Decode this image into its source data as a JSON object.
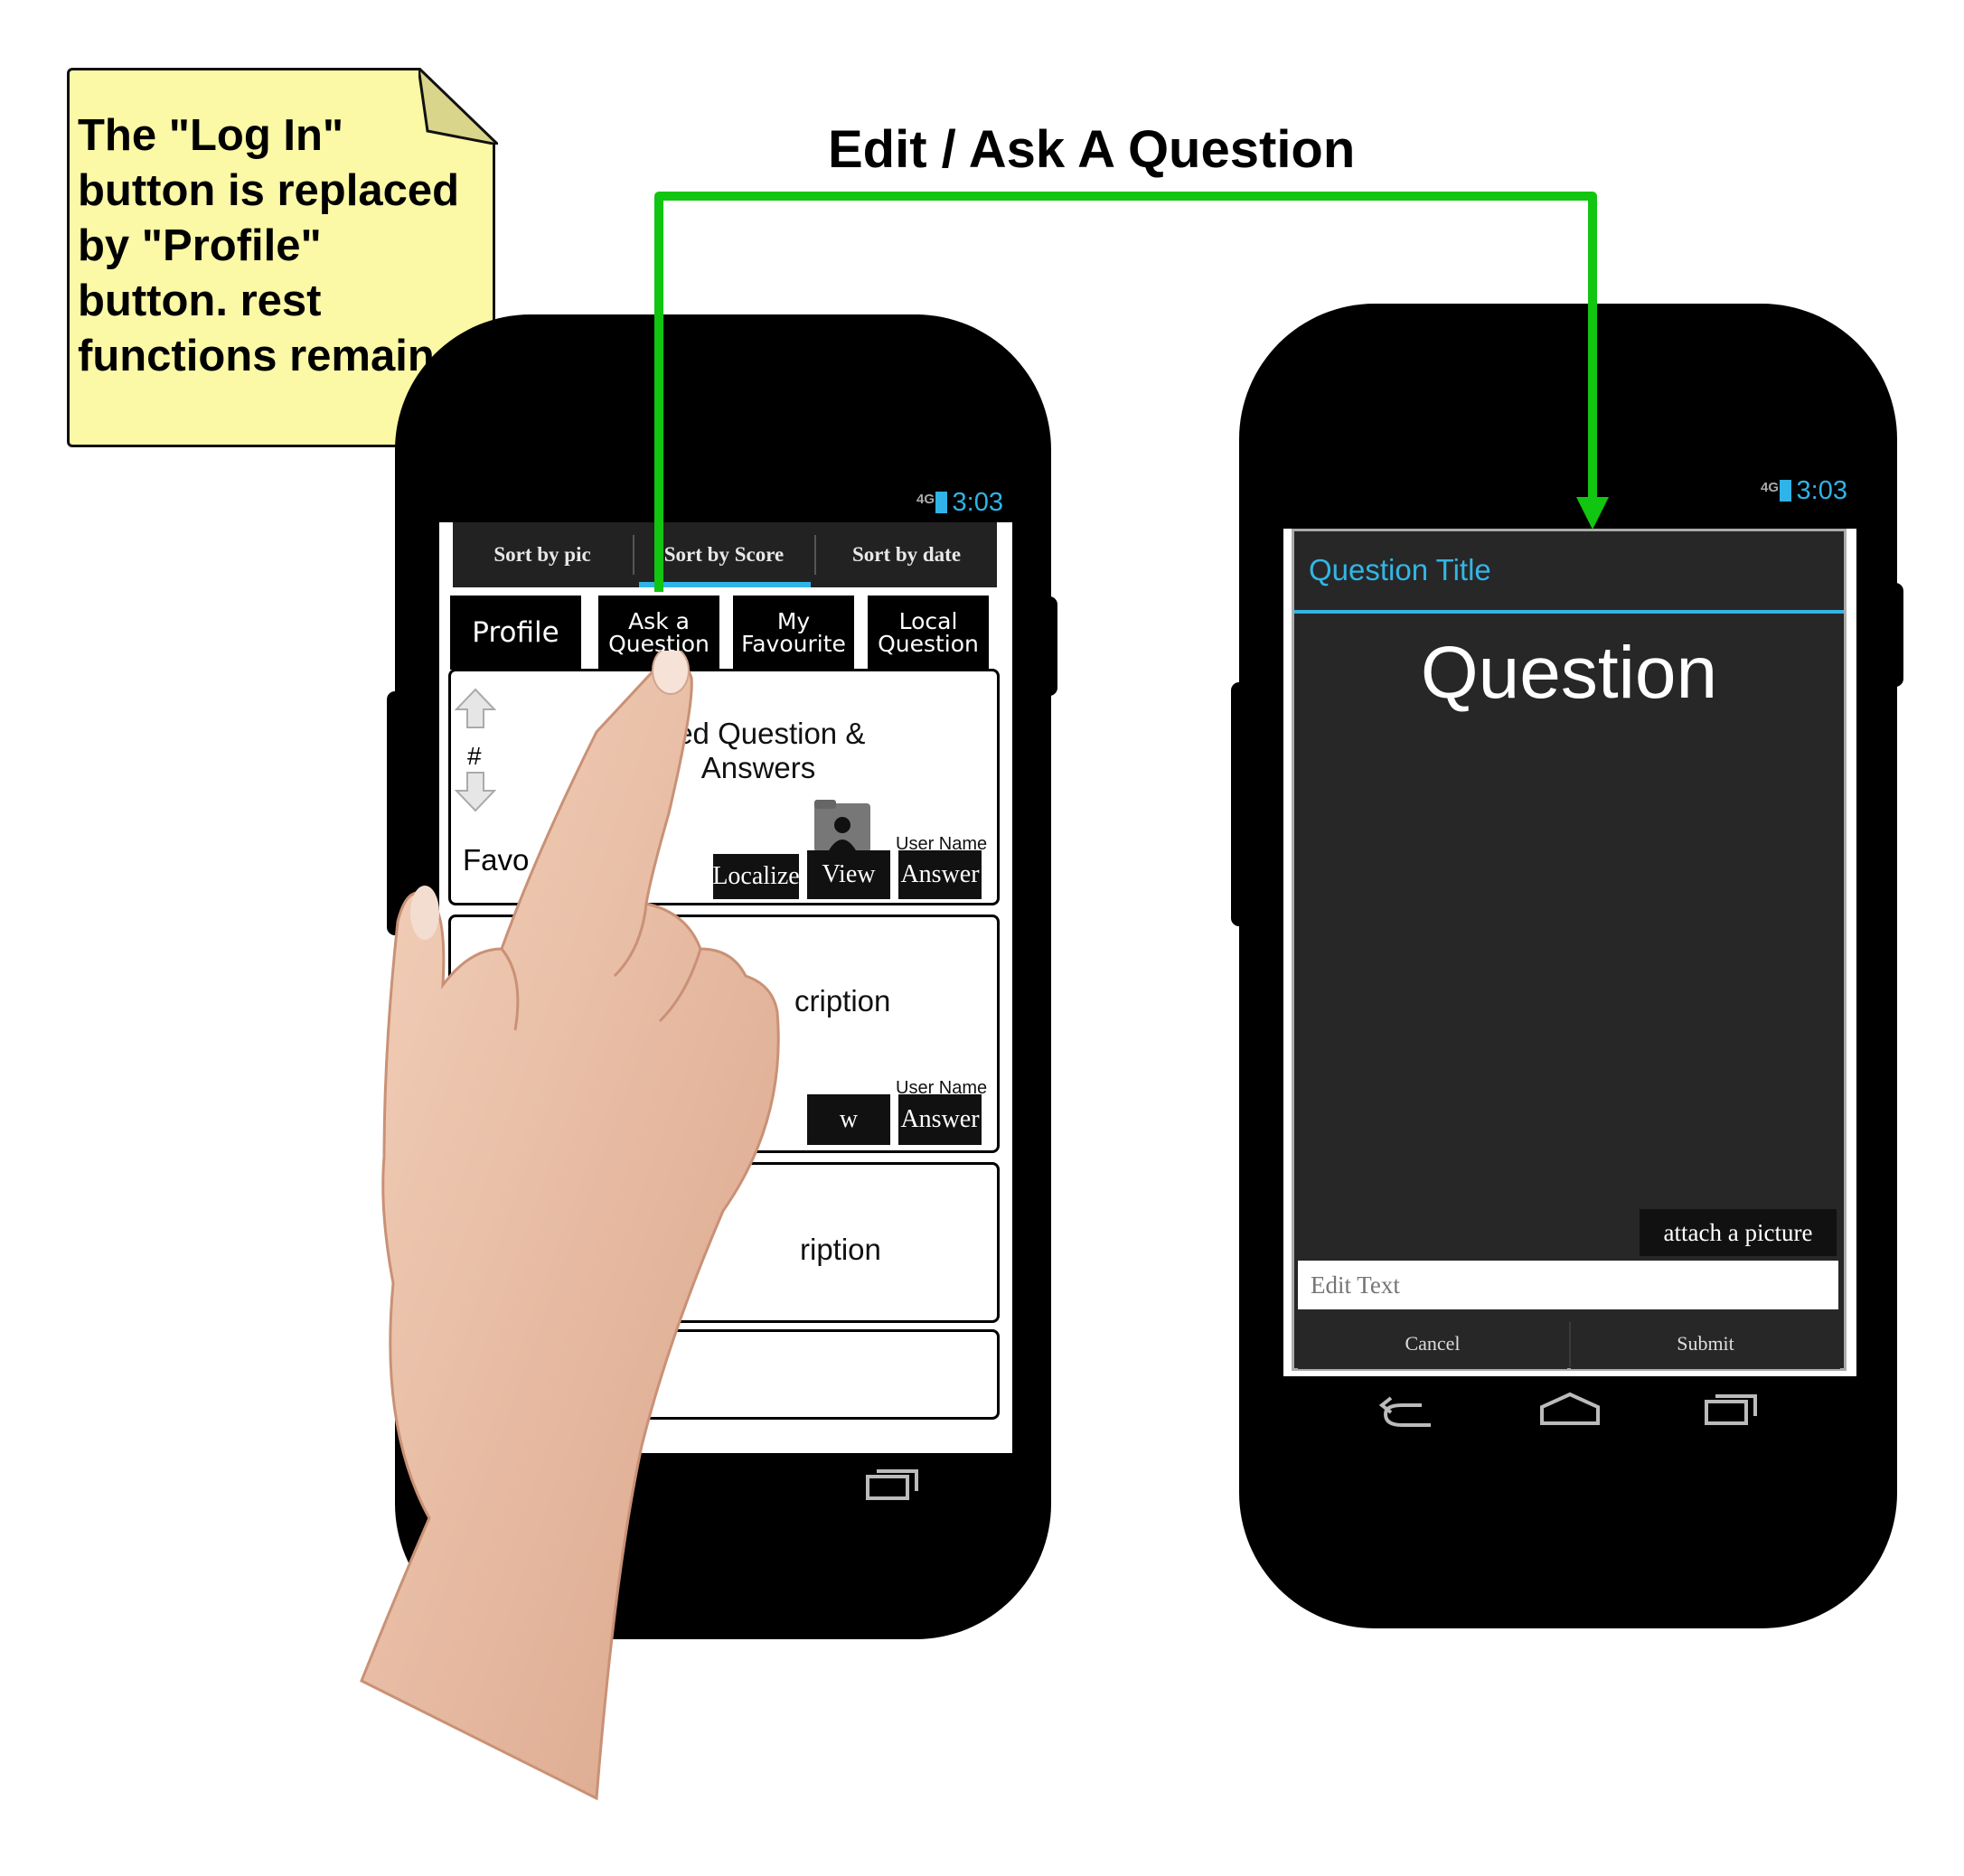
{
  "note": {
    "lines": [
      "The \"Log In\"",
      "button is replaced",
      "by \"Profile\"",
      "button. rest",
      "functions remain"
    ]
  },
  "flow": {
    "title": "Edit / Ask A Question",
    "arrow_color": "#11c511"
  },
  "phone1": {
    "status": {
      "network": "4G",
      "time": "3:03"
    },
    "tabs": [
      {
        "label": "Sort by pic"
      },
      {
        "label": "Sort by Score",
        "selected": true
      },
      {
        "label": "Sort by date"
      }
    ],
    "nav_buttons": {
      "profile": "Profile",
      "ask_line1": "Ask a",
      "ask_line2": "Question",
      "fav_line1": "My",
      "fav_line2": "Favourite",
      "local_line1": "Local",
      "local_line2": "Question"
    },
    "cards": [
      {
        "vote_label": "#",
        "favorite_label": "Favo",
        "title_line1": "oted Question &",
        "title_line2": "Answers",
        "user_name": "User Name",
        "localize": "Localize",
        "view": "View",
        "answer": "Answer"
      },
      {
        "title": "cription",
        "user_name": "User Name",
        "view": "w",
        "answer": "Answer"
      },
      {
        "title": "ription"
      }
    ]
  },
  "phone2": {
    "status": {
      "network": "4G",
      "time": "3:03"
    },
    "dialog": {
      "title": "Question Title",
      "heading": "Question",
      "attach": "attach a picture",
      "edit_placeholder": "Edit Text",
      "cancel": "Cancel",
      "submit": "Submit"
    }
  },
  "colors": {
    "accent": "#33b5e5",
    "note_bg": "#fbf8a6",
    "arrow": "#11c511"
  }
}
